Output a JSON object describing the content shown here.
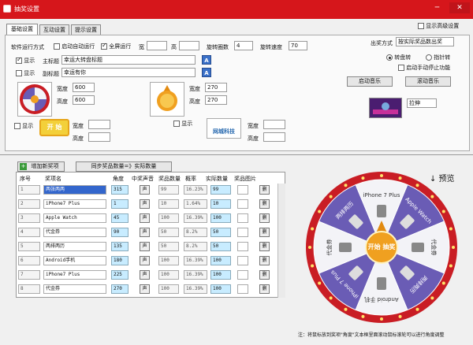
{
  "window": {
    "title": "抽奖设置",
    "min": "─",
    "close": "✕"
  },
  "tabs": [
    "基础设置",
    "互动设置",
    "提示设置"
  ],
  "advanced_label": "显示高级设置",
  "run_mode": {
    "label": "软件运行方式",
    "auto_run": "启动自动运行",
    "fullscreen": "全屏运行",
    "width_label": "宽",
    "height_label": "高",
    "spins_label": "旋转圈数",
    "spins": "4",
    "speed_label": "旋转速度",
    "speed": "70"
  },
  "titles": {
    "show": "显示",
    "main_label": "主标题",
    "main_value": "幸运大转盘标题",
    "sub_label": "副标题",
    "sub_value": "幸运有你",
    "font_btn": "A"
  },
  "sizes": {
    "w_label": "宽度",
    "h_label": "高度",
    "wheel_w": "600",
    "wheel_h": "600",
    "pointer_w": "270",
    "pointer_h": "270",
    "start_text": "开 始",
    "logo_text": "网城科技"
  },
  "output": {
    "label": "出奖方式",
    "value": "按实际奖品数出奖",
    "turntable": "转盘转",
    "pointer": "指针转",
    "auto_stop": "启动手动停止功能",
    "music1": "启动音乐",
    "music2": "滚动音乐",
    "stretch": "拉伸"
  },
  "add_btn": "增加新奖项",
  "sync_btn": "同步奖品数量=》实际数量",
  "table": {
    "headers": [
      "序号",
      "奖项名",
      "角度",
      "中奖声音",
      "奖品数量",
      "概率",
      "实际数量",
      "奖品图片"
    ],
    "sound_btn": "声",
    "del_btn": "删",
    "rows": [
      {
        "no": "1",
        "name": "两张两两",
        "angle": "315",
        "qty": "99",
        "prob": "16.23%",
        "actual": "99"
      },
      {
        "no": "2",
        "name": "iPhone7 Plus",
        "angle": "1",
        "qty": "10",
        "prob": "1.64%",
        "actual": "10"
      },
      {
        "no": "3",
        "name": "Apple Watch",
        "angle": "45",
        "qty": "100",
        "prob": "16.39%",
        "actual": "100"
      },
      {
        "no": "4",
        "name": "代金券",
        "angle": "90",
        "qty": "50",
        "prob": "8.2%",
        "actual": "50"
      },
      {
        "no": "5",
        "name": "两排两历",
        "angle": "135",
        "qty": "50",
        "prob": "8.2%",
        "actual": "50"
      },
      {
        "no": "6",
        "name": "Android手机",
        "angle": "180",
        "qty": "100",
        "prob": "16.39%",
        "actual": "100"
      },
      {
        "no": "7",
        "name": "iPhone7 Plus",
        "angle": "225",
        "qty": "100",
        "prob": "16.39%",
        "actual": "100"
      },
      {
        "no": "8",
        "name": "代金券",
        "angle": "270",
        "qty": "100",
        "prob": "16.39%",
        "actual": "100"
      }
    ]
  },
  "preview_label": "↓ 预览",
  "wheel": {
    "segments": [
      "iPhone 7 Plus",
      "Apple Watch",
      "代金券",
      "两排两历",
      "Android 手机",
      "iPhone 7 Plus",
      "代金券",
      "两排两历"
    ],
    "center": "开始 抽奖"
  },
  "note": "注：将鼠标放到奖项\"角度\"文本框里面滚动鼠标滚轮可以进行角度调整",
  "colors": {
    "title_red": "#d6161b",
    "wheel_red": "#c91d24",
    "wheel_purple": "#6a5cb5",
    "wheel_white": "#f3f3f7",
    "gold": "#f0a020"
  }
}
